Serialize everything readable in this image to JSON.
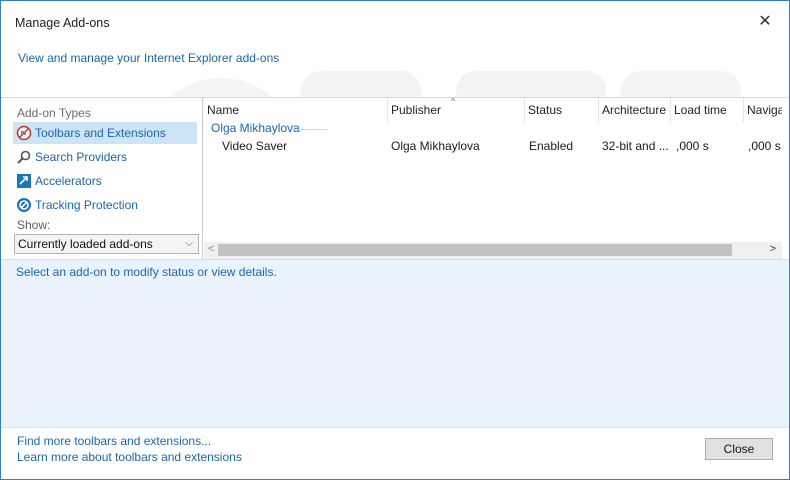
{
  "window": {
    "title": "Manage Add-ons",
    "close_icon": "close-icon",
    "subtitle": "View and manage your Internet Explorer add-ons"
  },
  "left_pane": {
    "header": "Add-on Types",
    "items": [
      {
        "label": "Toolbars and Extensions",
        "icon": "toolbar-extension-icon",
        "selected": true
      },
      {
        "label": "Search Providers",
        "icon": "search-icon",
        "selected": false
      },
      {
        "label": "Accelerators",
        "icon": "accelerator-icon",
        "selected": false
      },
      {
        "label": "Tracking Protection",
        "icon": "tracking-protection-icon",
        "selected": false
      }
    ],
    "show_label": "Show:",
    "show_dropdown": {
      "selected": "Currently loaded add-ons"
    }
  },
  "addon_list": {
    "columns": [
      "Name",
      "Publisher",
      "Status",
      "Architecture",
      "Load time",
      "Naviga"
    ],
    "groups": [
      {
        "name": "Olga Mikhaylova",
        "rows": [
          [
            "Video Saver",
            "Olga Mikhaylova",
            "Enabled",
            "32-bit and ...",
            ",000 s",
            ",000 s"
          ]
        ]
      }
    ]
  },
  "details": {
    "text": "Select an add-on to modify status or view details."
  },
  "footer": {
    "link_find": "Find more toolbars and extensions...",
    "link_learn": "Learn more about toolbars and extensions",
    "close_button": "Close"
  },
  "colors": {
    "accent_link": "#1a64b8",
    "selected_bg": "#cde4f7",
    "details_bg": "#eaf3fb",
    "window_border": "#2b7fd6"
  }
}
